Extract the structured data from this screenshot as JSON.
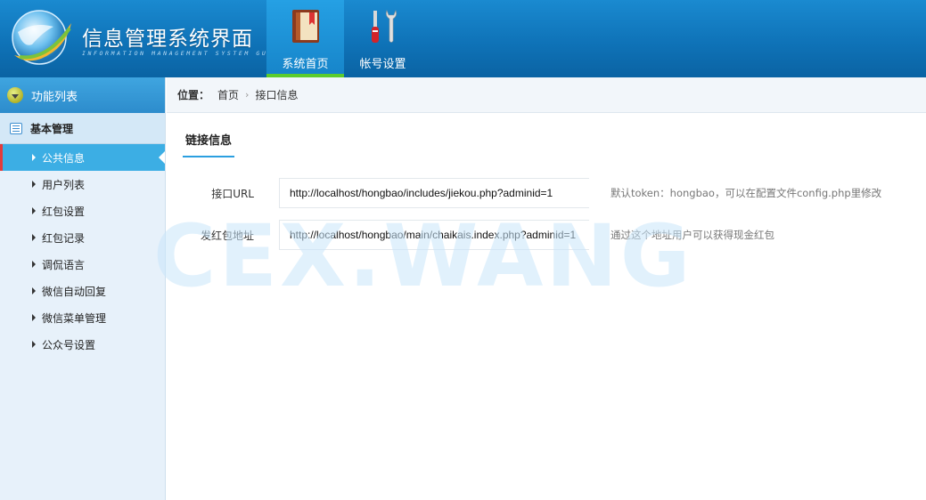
{
  "app": {
    "title": "信息管理系统界面",
    "subtitle": "INFORMATION MANAGEMENT SYSTEM GUI"
  },
  "nav": {
    "items": [
      {
        "label": "系统首页",
        "icon": "book-icon",
        "active": true
      },
      {
        "label": "帐号设置",
        "icon": "tools-icon",
        "active": false
      }
    ]
  },
  "sidebar": {
    "header": "功能列表",
    "group": "基本管理",
    "items": [
      {
        "label": "公共信息",
        "active": true
      },
      {
        "label": "用户列表"
      },
      {
        "label": "红包设置"
      },
      {
        "label": "红包记录"
      },
      {
        "label": "调侃语言"
      },
      {
        "label": "微信自动回复"
      },
      {
        "label": "微信菜单管理"
      },
      {
        "label": "公众号设置"
      }
    ]
  },
  "breadcrumb": {
    "label": "位置：",
    "items": [
      "首页",
      "接口信息"
    ]
  },
  "content": {
    "section_title": "链接信息",
    "rows": [
      {
        "label": "接口URL",
        "value": "http://localhost/hongbao/includes/jiekou.php?adminid=1",
        "hint": "默认token：hongbao，可以在配置文件config.php里修改"
      },
      {
        "label": "发红包地址",
        "value": "http://localhost/hongbao/main/chaikais.index.php?adminid=1",
        "hint": "通过这个地址用户可以获得现金红包"
      }
    ]
  },
  "watermark": "CEX.WANG",
  "colors": {
    "header": "#0f73b8",
    "nav_active": "#1f94d8",
    "nav_active_bar": "#5ccc2c",
    "sidebar_bg": "#e7f1fa",
    "menu_active": "#3caee4",
    "menu_active_marker": "#e43b3b",
    "section_underline": "#2b9fe0"
  }
}
